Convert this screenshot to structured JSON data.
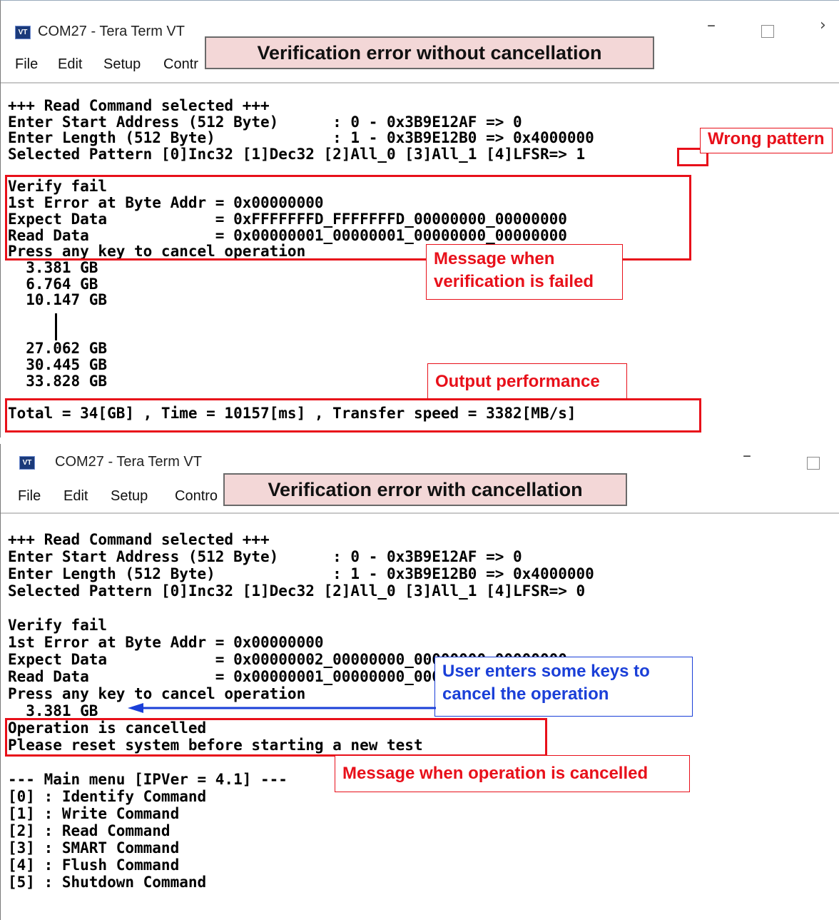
{
  "top": {
    "window_title": "COM27 - Tera Term VT",
    "menu": [
      "File",
      "Edit",
      "Setup",
      "Contr"
    ],
    "banner": "Verification error without cancellation",
    "lines": [
      "+++ Read Command selected +++",
      "Enter Start Address (512 Byte)      : 0 - 0x3B9E12AF => 0",
      "Enter Length (512 Byte)             : 1 - 0x3B9E12B0 => 0x4000000",
      "Selected Pattern [0]Inc32 [1]Dec32 [2]All_0 [3]All_1 [4]LFSR=> 1",
      "",
      "Verify fail",
      "1st Error at Byte Addr = 0x00000000",
      "Expect Data            = 0xFFFFFFFD_FFFFFFFD_00000000_00000000",
      "Read Data              = 0x00000001_00000001_00000000_00000000",
      "Press any key to cancel operation",
      "  3.381 GB",
      "  6.764 GB",
      "  10.147 GB",
      "",
      "",
      "  27.062 GB",
      "  30.445 GB",
      "  33.828 GB",
      "",
      "Total = 34[GB] , Time = 10157[ms] , Transfer speed = 3382[MB/s]"
    ],
    "callouts": {
      "wrong_pattern": "Wrong pattern",
      "verify_failed_1": "Message when",
      "verify_failed_2": "verification is failed",
      "output_performance": "Output performance"
    }
  },
  "bottom": {
    "window_title": "COM27 - Tera Term VT",
    "menu": [
      "File",
      "Edit",
      "Setup",
      "Contro"
    ],
    "banner": "Verification error with cancellation",
    "lines": [
      "+++ Read Command selected +++",
      "Enter Start Address (512 Byte)      : 0 - 0x3B9E12AF => 0",
      "Enter Length (512 Byte)             : 1 - 0x3B9E12B0 => 0x4000000",
      "Selected Pattern [0]Inc32 [1]Dec32 [2]All_0 [3]All_1 [4]LFSR=> 0",
      "",
      "Verify fail",
      "1st Error at Byte Addr = 0x00000000",
      "Expect Data            = 0x00000002_00000000_00000000_00000000",
      "Read Data              = 0x00000001_00000000_00000000_00000000",
      "Press any key to cancel operation",
      "  3.381 GB",
      "Operation is cancelled",
      "Please reset system before starting a new test",
      "",
      "--- Main menu [IPVer = 4.1] ---",
      "[0] : Identify Command",
      "[1] : Write Command",
      "[2] : Read Command",
      "[3] : SMART Command",
      "[4] : Flush Command",
      "[5] : Shutdown Command"
    ],
    "callouts": {
      "user_keys_1": "User enters some keys to",
      "user_keys_2": "cancel the operation",
      "cancelled": "Message when operation is cancelled"
    }
  },
  "colors": {
    "annotation_red": "#e8101a",
    "annotation_blue": "#1a3fd8",
    "banner_bg": "#f3d7d7"
  },
  "icons": {
    "app": "tera-term-icon",
    "minimize": "minimize-icon",
    "maximize": "maximize-icon",
    "close": "close-icon"
  },
  "icon_glyph": "VT"
}
